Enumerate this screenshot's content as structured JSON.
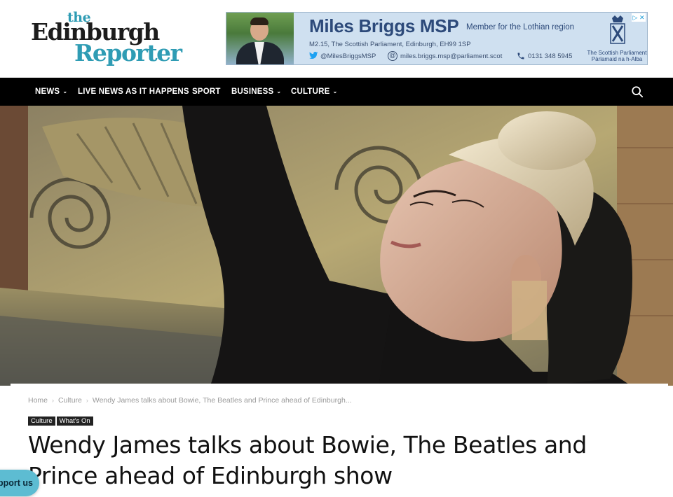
{
  "site": {
    "logo": {
      "word1": "the",
      "word2": "Edinburgh",
      "word3": "Reporter"
    }
  },
  "ad": {
    "name": "Miles Briggs MSP",
    "role": "Member for the Lothian region",
    "address": "M2.15, The Scottish Parliament, Edinburgh, EH99 1SP",
    "twitter": "@MilesBriggsMSP",
    "email": "miles.briggs.msp@parliament.scot",
    "phone": "0131 348 5945",
    "parliament_en": "The Scottish Parliament",
    "parliament_gd": "Pàrlamaid na h-Alba",
    "badge": "▷ ✕"
  },
  "nav": {
    "items": [
      {
        "label": "NEWS",
        "has_dropdown": true
      },
      {
        "label": "LIVE NEWS AS IT HAPPENS",
        "has_dropdown": false
      },
      {
        "label": "SPORT",
        "has_dropdown": false
      },
      {
        "label": "BUSINESS",
        "has_dropdown": true
      },
      {
        "label": "CULTURE",
        "has_dropdown": true
      }
    ],
    "dropdown_glyph": "⌄"
  },
  "breadcrumb": {
    "items": [
      "Home",
      "Culture",
      "Wendy James talks about Bowie, The Beatles and Prince ahead of Edinburgh..."
    ],
    "separator": "›"
  },
  "tags": [
    "Culture",
    "What's On"
  ],
  "article": {
    "title": "Wendy James talks about Bowie, The Beatles and Prince ahead of Edinburgh show"
  },
  "support_button": {
    "label": "Support us"
  },
  "colors": {
    "brand_teal": "#2f9cb4",
    "nav_bg": "#000000",
    "tag_bg": "#222222",
    "support_bg": "#5dbcd2"
  }
}
